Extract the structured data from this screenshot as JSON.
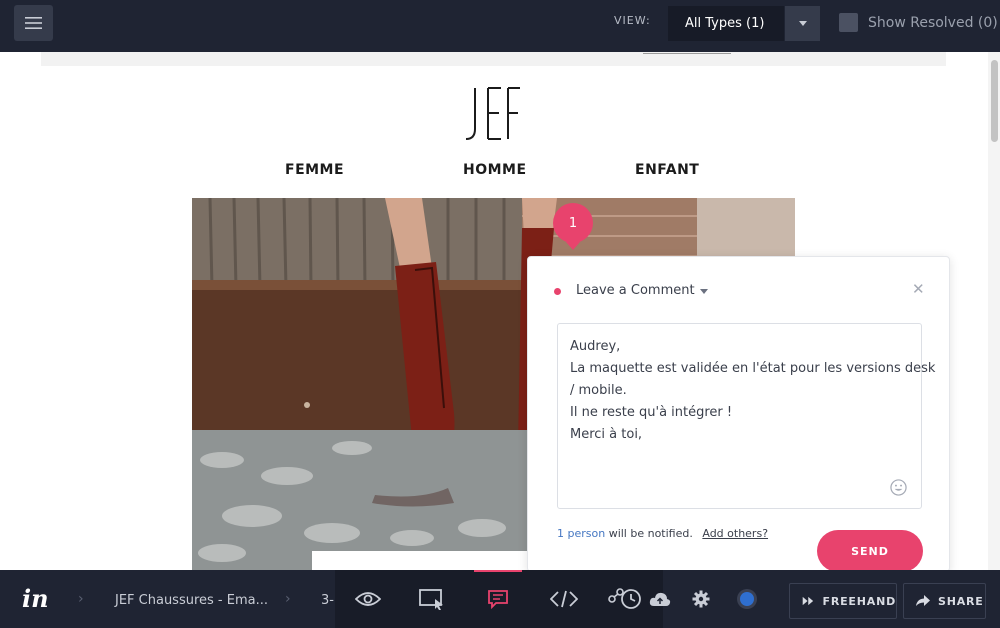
{
  "topbar": {
    "view_label": "VIEW:",
    "view_value": "All Types (1)",
    "show_resolved": "Show Resolved (0)"
  },
  "page": {
    "logo_text": "JEF",
    "nav": [
      "FEMME",
      "HOMME",
      "ENFANT"
    ]
  },
  "pin": {
    "number": "1"
  },
  "comment": {
    "title": "Leave a Comment",
    "lines": [
      "Audrey,",
      "La maquette est validée en l'état pour les versions desk",
      "/ mobile.",
      "Il ne reste qu'à intégrer !",
      "Merci à toi,"
    ],
    "notify_people": "1 person",
    "notify_rest": " will be notified.",
    "add_others": "Add others?",
    "send_label": "SEND"
  },
  "bottombar": {
    "project": "JEF Chaussures - Ema...",
    "screen": "3-",
    "freehand_label": "FREEHAND",
    "share_label": "SHARE"
  },
  "colors": {
    "accent": "#e8436d",
    "bar_bg": "#1f2433",
    "link": "#4577c2",
    "status_dot": "#2f6fd0"
  },
  "icons": [
    "menu-icon",
    "caret-down-icon",
    "checkbox-icon",
    "close-icon",
    "emoji-icon",
    "invision-logo",
    "chevron-right-icon",
    "eye-icon",
    "select-area-icon",
    "comment-icon",
    "code-icon",
    "history-icon",
    "cloud-icon",
    "gear-icon",
    "freehand-icon",
    "share-icon"
  ]
}
